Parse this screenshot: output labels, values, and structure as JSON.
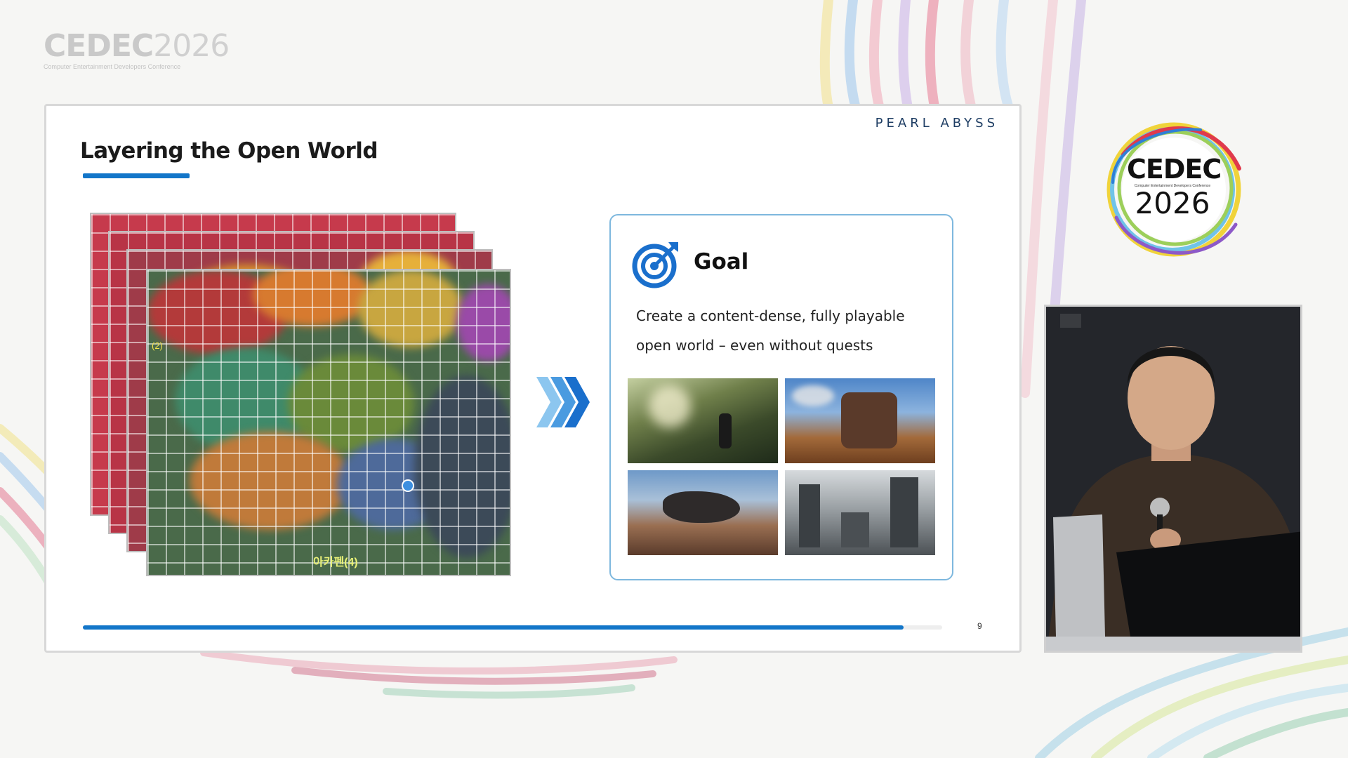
{
  "conference": {
    "logo_word": "CEDEC",
    "logo_year": "2026",
    "logo_subtitle": "Computer Entertainment Developers Conference",
    "badge_subtitle": "Computer Entertainment Developers Conference"
  },
  "slide": {
    "brand": "PEARL ABYSS",
    "title": "Layering the Open World",
    "map_labels": {
      "region_a": "(2)",
      "region_b": "아카펜(4)"
    },
    "goal": {
      "heading": "Goal",
      "text": "Create a content-dense, fully playable open world – even without quests"
    },
    "progress_fraction": 0.955,
    "page_number": "9"
  },
  "colors": {
    "accent": "#1376c9",
    "card_border": "#7eb8de",
    "brand_text": "#1f3e64"
  },
  "icons": {
    "goal": "target-icon",
    "next": "chevron-right-icon"
  }
}
